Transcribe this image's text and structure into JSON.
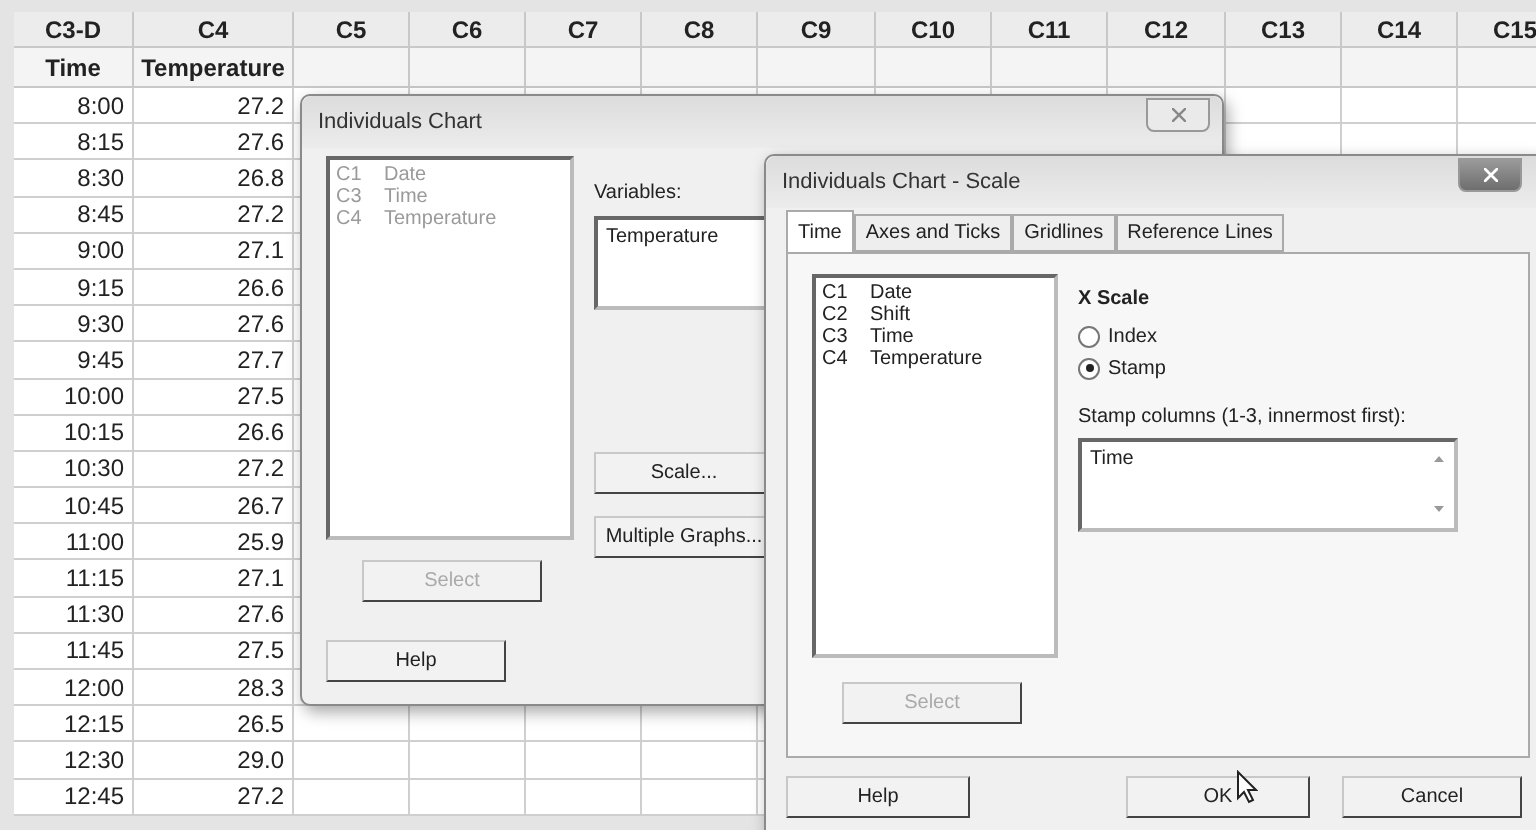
{
  "worksheet": {
    "columns": [
      {
        "id": "C3-D",
        "name": "Time"
      },
      {
        "id": "C4",
        "name": "Temperature"
      },
      {
        "id": "C5"
      },
      {
        "id": "C6"
      },
      {
        "id": "C7"
      },
      {
        "id": "C8"
      },
      {
        "id": "C9"
      },
      {
        "id": "C10"
      },
      {
        "id": "C11"
      },
      {
        "id": "C12"
      },
      {
        "id": "C13"
      },
      {
        "id": "C14"
      },
      {
        "id": "C15"
      }
    ],
    "rows": [
      [
        "8:00",
        "27.2"
      ],
      [
        "8:15",
        "27.6"
      ],
      [
        "8:30",
        "26.8"
      ],
      [
        "8:45",
        "27.2"
      ],
      [
        "9:00",
        "27.1"
      ],
      [
        "9:15",
        "26.6"
      ],
      [
        "9:30",
        "27.6"
      ],
      [
        "9:45",
        "27.7"
      ],
      [
        "10:00",
        "27.5"
      ],
      [
        "10:15",
        "26.6"
      ],
      [
        "10:30",
        "27.2"
      ],
      [
        "10:45",
        "26.7"
      ],
      [
        "11:00",
        "25.9"
      ],
      [
        "11:15",
        "27.1"
      ],
      [
        "11:30",
        "27.6"
      ],
      [
        "11:45",
        "27.5"
      ],
      [
        "12:00",
        "28.3"
      ],
      [
        "12:15",
        "26.5"
      ],
      [
        "12:30",
        "29.0"
      ],
      [
        "12:45",
        "27.2"
      ]
    ]
  },
  "chart_dialog": {
    "title": "Individuals Chart",
    "columns_disabled": true,
    "columns": [
      {
        "id": "C1",
        "name": "Date"
      },
      {
        "id": "C3",
        "name": "Time"
      },
      {
        "id": "C4",
        "name": "Temperature"
      }
    ],
    "variables_label": "Variables:",
    "variables_value": "Temperature",
    "scale_button": "Scale...",
    "multiple_graphs_button": "Multiple Graphs...",
    "select_button": {
      "label": "Select",
      "disabled": true
    },
    "help_button": "Help"
  },
  "scale_dialog": {
    "title": "Individuals Chart - Scale",
    "tabs": [
      {
        "label": "Time",
        "selected": true
      },
      {
        "label": "Axes and Ticks",
        "selected": false
      },
      {
        "label": "Gridlines",
        "selected": false
      },
      {
        "label": "Reference Lines",
        "selected": false
      }
    ],
    "columns": [
      {
        "id": "C1",
        "name": "Date"
      },
      {
        "id": "C2",
        "name": "Shift"
      },
      {
        "id": "C3",
        "name": "Time"
      },
      {
        "id": "C4",
        "name": "Temperature"
      }
    ],
    "x_scale_label": "X Scale",
    "x_scale_options": [
      {
        "label": "Index",
        "selected": false
      },
      {
        "label": "Stamp",
        "selected": true
      }
    ],
    "stamp_label": "Stamp columns (1-3, innermost first):",
    "stamp_value": "Time",
    "select_button": {
      "label": "Select",
      "disabled": true
    },
    "buttons": [
      "Help",
      "OK",
      "Cancel"
    ]
  }
}
